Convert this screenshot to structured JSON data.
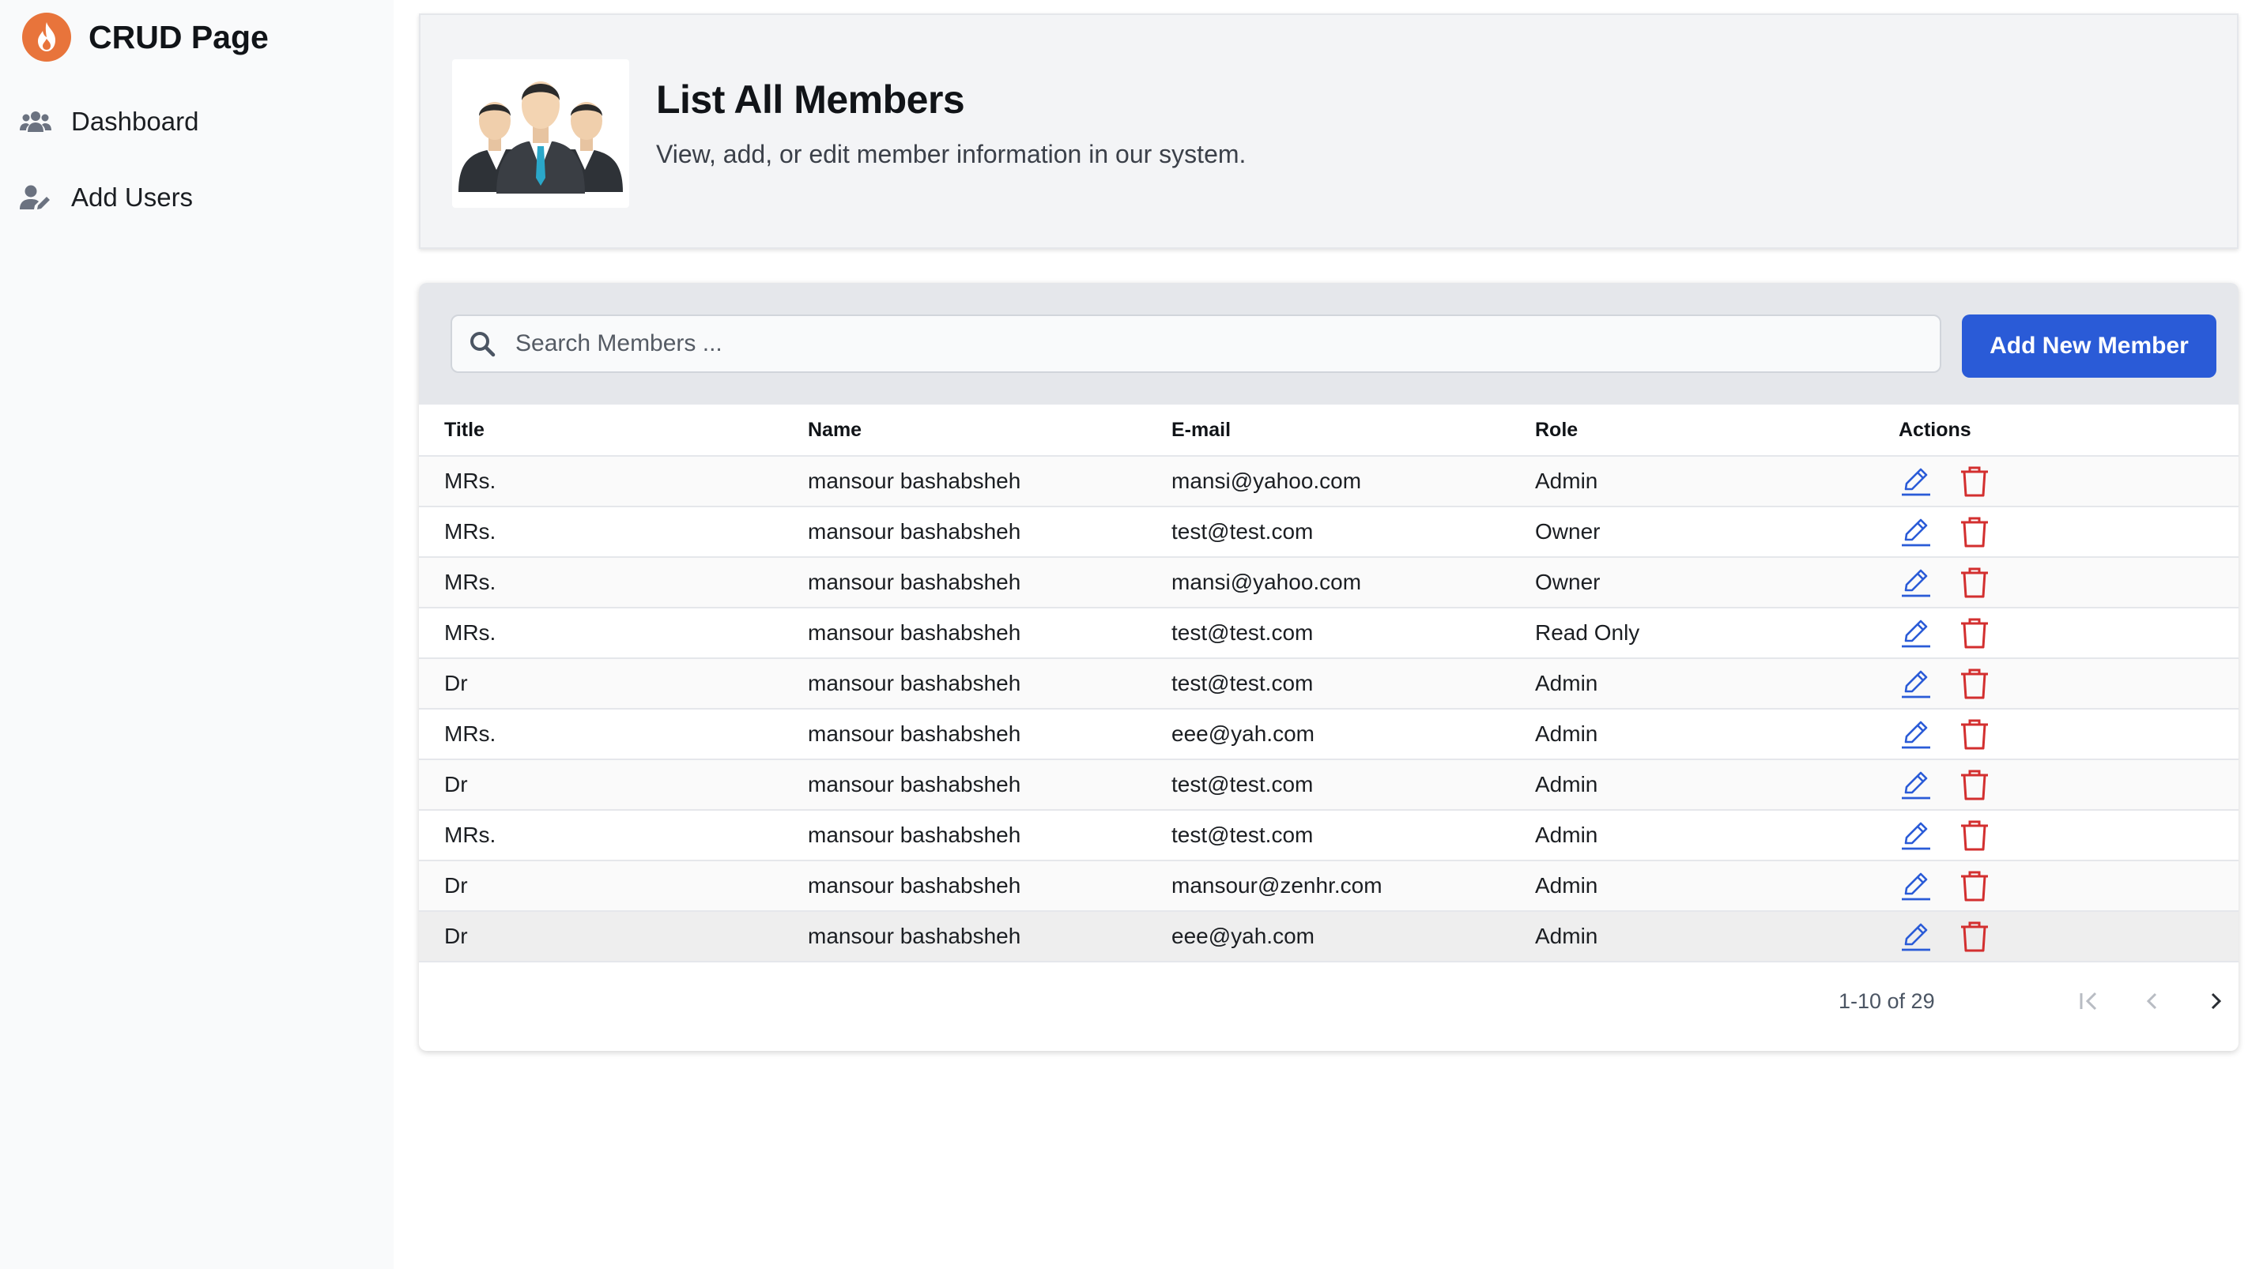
{
  "brand": {
    "title": "CRUD Page",
    "logo_icon": "flame-logo-icon",
    "accent": "#e8743b"
  },
  "sidebar": {
    "items": [
      {
        "label": "Dashboard",
        "icon": "users-group-icon"
      },
      {
        "label": "Add Users",
        "icon": "user-edit-icon"
      }
    ]
  },
  "header": {
    "title": "List All Members",
    "subtitle": "View, add, or edit member information in our system."
  },
  "search": {
    "placeholder": "Search Members ...",
    "value": ""
  },
  "toolbar": {
    "add_label": "Add New Member",
    "add_color": "#2a5bd7"
  },
  "table": {
    "columns": [
      "Title",
      "Name",
      "E-mail",
      "Role",
      "Actions"
    ],
    "rows": [
      {
        "title": "MRs.",
        "name": "mansour bashabsheh",
        "email": "mansi@yahoo.com",
        "role": "Admin"
      },
      {
        "title": "MRs.",
        "name": "mansour bashabsheh",
        "email": "test@test.com",
        "role": "Owner"
      },
      {
        "title": "MRs.",
        "name": "mansour bashabsheh",
        "email": "mansi@yahoo.com",
        "role": "Owner"
      },
      {
        "title": "MRs.",
        "name": "mansour bashabsheh",
        "email": "test@test.com",
        "role": "Read Only"
      },
      {
        "title": "Dr",
        "name": "mansour bashabsheh",
        "email": "test@test.com",
        "role": "Admin"
      },
      {
        "title": "MRs.",
        "name": "mansour bashabsheh",
        "email": "eee@yah.com",
        "role": "Admin"
      },
      {
        "title": "Dr",
        "name": "mansour bashabsheh",
        "email": "test@test.com",
        "role": "Admin"
      },
      {
        "title": "MRs.",
        "name": "mansour bashabsheh",
        "email": "test@test.com",
        "role": "Admin"
      },
      {
        "title": "Dr",
        "name": "mansour bashabsheh",
        "email": "mansour@zenhr.com",
        "role": "Admin"
      },
      {
        "title": "Dr",
        "name": "mansour bashabsheh",
        "email": "eee@yah.com",
        "role": "Admin"
      }
    ],
    "edit_color": "#2a5bd7",
    "delete_color": "#d32f2f"
  },
  "pagination": {
    "range_text": "1-10 of 29"
  }
}
